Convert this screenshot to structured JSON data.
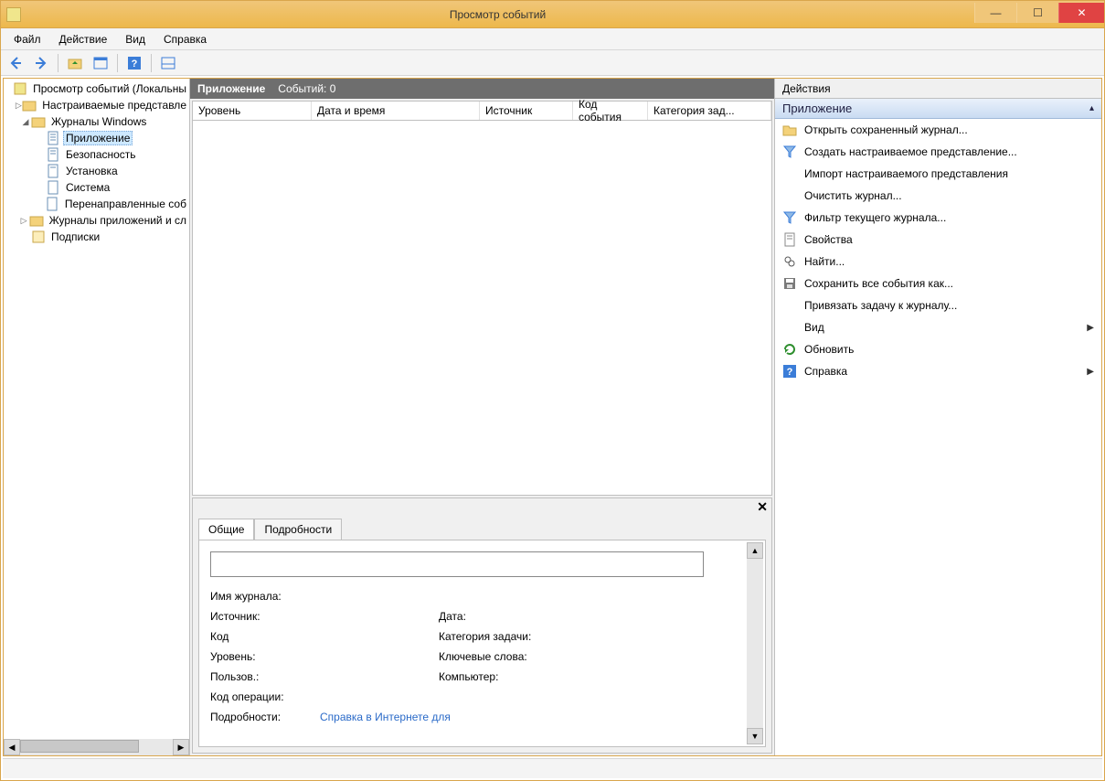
{
  "titlebar": {
    "title": "Просмотр событий"
  },
  "menu": {
    "file": "Файл",
    "action": "Действие",
    "view": "Вид",
    "help": "Справка"
  },
  "tree": {
    "root": "Просмотр событий (Локальны",
    "custom_views": "Настраиваемые представле",
    "windows_logs": "Журналы Windows",
    "application": "Приложение",
    "security": "Безопасность",
    "setup": "Установка",
    "system": "Система",
    "forwarded": "Перенаправленные соб",
    "app_services_logs": "Журналы приложений и сл",
    "subscriptions": "Подписки"
  },
  "grid_header": {
    "title": "Приложение",
    "count": "Событий: 0"
  },
  "grid_cols": {
    "level": "Уровень",
    "datetime": "Дата и время",
    "source": "Источник",
    "eventid": "Код события",
    "category": "Категория зад..."
  },
  "detail": {
    "tab_general": "Общие",
    "tab_details": "Подробности",
    "log_name": "Имя журнала:",
    "source": "Источник:",
    "date": "Дата:",
    "code": "Код",
    "task_category": "Категория задачи:",
    "level": "Уровень:",
    "keywords": "Ключевые слова:",
    "user": "Пользов.:",
    "computer": "Компьютер:",
    "opcode": "Код операции:",
    "more": "Подробности:",
    "help_link": "Справка в Интернете для"
  },
  "actions": {
    "panel_title": "Действия",
    "section": "Приложение",
    "open_saved": "Открыть сохраненный журнал...",
    "create_custom_view": "Создать настраиваемое представление...",
    "import_custom_view": "Импорт настраиваемого представления",
    "clear_log": "Очистить журнал...",
    "filter_log": "Фильтр текущего журнала...",
    "properties": "Свойства",
    "find": "Найти...",
    "save_all": "Сохранить все события как...",
    "attach_task": "Привязать задачу к журналу...",
    "view": "Вид",
    "refresh": "Обновить",
    "help": "Справка"
  }
}
